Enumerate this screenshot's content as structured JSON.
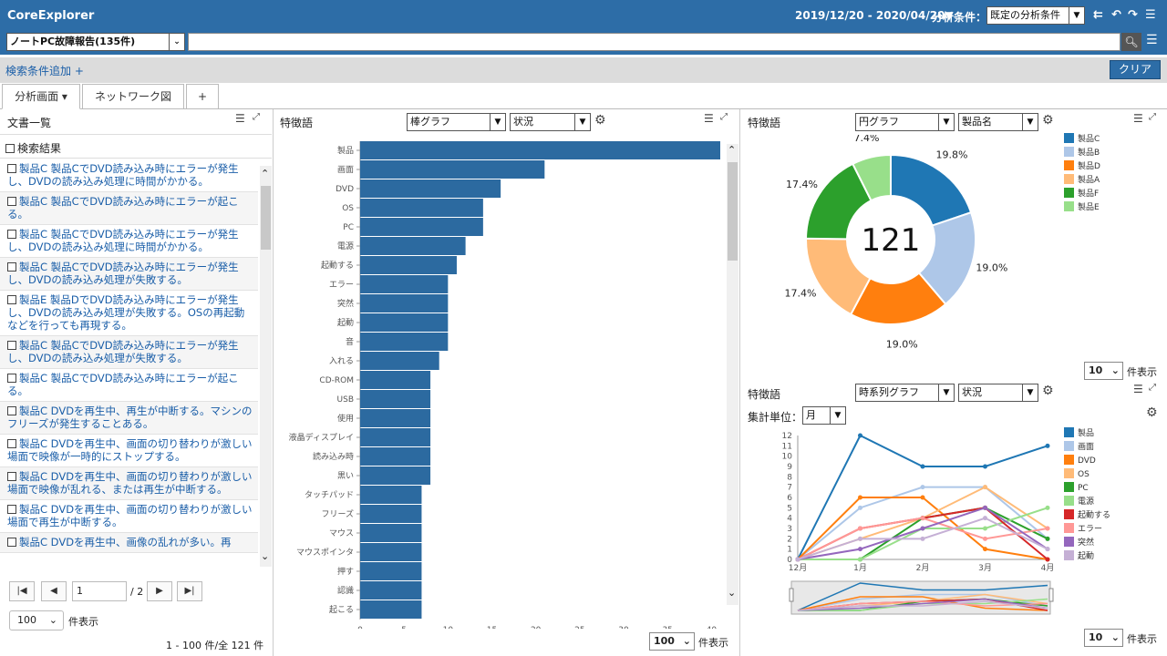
{
  "app": {
    "title": "CoreExplorer"
  },
  "header": {
    "date_range": "2019/12/20 - 2020/04/20▼",
    "condition_label": "分析条件：",
    "condition_value": "既定の分析条件",
    "icons": [
      "undo-all-icon",
      "undo-icon",
      "redo-icon",
      "menu-icon"
    ]
  },
  "search": {
    "dataset": "ノートPC故障報告(135件)",
    "query": ""
  },
  "filters": {
    "add_label": "検索条件追加 +",
    "clear_label": "クリア"
  },
  "tabs": [
    {
      "label": "分析画面 ▾"
    },
    {
      "label": "ネットワーク図"
    },
    {
      "label": "+"
    }
  ],
  "doc_panel": {
    "title": "文書一覧",
    "results_label": "検索結果",
    "docs": [
      "製品C 製品CでDVD読み込み時にエラーが発生し、DVDの読み込み処理に時間がかかる。",
      "製品C 製品CでDVD読み込み時にエラーが起こる。",
      "製品C 製品CでDVD読み込み時にエラーが発生し、DVDの読み込み処理に時間がかかる。",
      "製品C 製品CでDVD読み込み時にエラーが発生し、DVDの読み込み処理が失敗する。",
      "製品E 製品DでDVD読み込み時にエラーが発生し、DVDの読み込み処理が失敗する。OSの再起動などを行っても再現する。",
      "製品C 製品CでDVD読み込み時にエラーが発生し、DVDの読み込み処理が失敗する。",
      "製品C 製品CでDVD読み込み時にエラーが起こる。",
      "製品C DVDを再生中、再生が中断する。マシンのフリーズが発生することある。",
      "製品C DVDを再生中、画面の切り替わりが激しい場面で映像が一時的にストップする。",
      "製品C DVDを再生中、画面の切り替わりが激しい場面で映像が乱れる、または再生が中断する。",
      "製品C DVDを再生中、画面の切り替わりが激しい場面で再生が中断する。",
      "製品C DVDを再生中、画像の乱れが多い。再"
    ],
    "page": "1",
    "page_total": "/ 2",
    "per_page": "100",
    "per_page_label": "件表示",
    "range_label": "1 - 100 件/全 121 件"
  },
  "bar_panel": {
    "title": "特徴語",
    "chart_type": "棒グラフ",
    "field": "状況",
    "per_page": "100",
    "per_page_label": "件表示"
  },
  "pie_panel": {
    "title": "特徴語",
    "chart_type": "円グラフ",
    "field": "製品名",
    "center_value": "121",
    "per_page": "10",
    "per_page_label": "件表示"
  },
  "line_panel": {
    "title": "特徴語",
    "chart_type": "時系列グラフ",
    "field": "状況",
    "unit_label": "集計単位：",
    "unit_value": "月",
    "per_page": "10",
    "per_page_label": "件表示"
  },
  "chart_data": [
    {
      "type": "bar",
      "orientation": "horizontal",
      "categories": [
        "製品",
        "画面",
        "DVD",
        "OS",
        "PC",
        "電源",
        "起動する",
        "エラー",
        "突然",
        "起動",
        "音",
        "入れる",
        "CD-ROM",
        "USB",
        "使用",
        "液晶ディスプレイ",
        "読み込み時",
        "黒い",
        "タッチパッド",
        "フリーズ",
        "マウス",
        "マウスポインタ",
        "押す",
        "認識",
        "起こる"
      ],
      "values": [
        41,
        21,
        16,
        14,
        14,
        12,
        11,
        10,
        10,
        10,
        10,
        9,
        8,
        8,
        8,
        8,
        8,
        8,
        7,
        7,
        7,
        7,
        7,
        7,
        7
      ],
      "xlim": [
        0,
        41
      ],
      "xticks": [
        0,
        5,
        10,
        15,
        20,
        25,
        30,
        35,
        40
      ],
      "color": "#2c6aa0"
    },
    {
      "type": "pie",
      "style": "donut",
      "labels": [
        "製品C",
        "製品B",
        "製品D",
        "製品A",
        "製品F",
        "製品E"
      ],
      "values": [
        19.8,
        19.0,
        19.0,
        17.4,
        17.4,
        7.4
      ],
      "value_labels": [
        "19.8%",
        "19.0%",
        "19.0%",
        "17.4%",
        "17.4%",
        "7.4%"
      ],
      "colors": [
        "#1f77b4",
        "#aec7e8",
        "#ff7f0e",
        "#ffbb78",
        "#2ca02c",
        "#98df8a"
      ]
    },
    {
      "type": "line",
      "x": [
        "12月",
        "1月",
        "2月",
        "3月",
        "4月"
      ],
      "ylim": [
        0,
        12
      ],
      "yticks": [
        0,
        1,
        2,
        3,
        4,
        5,
        6,
        7,
        8,
        9,
        10,
        11,
        12
      ],
      "series": [
        {
          "name": "製品",
          "color": "#1f77b4",
          "values": [
            0,
            12,
            9,
            9,
            11
          ]
        },
        {
          "name": "画面",
          "color": "#aec7e8",
          "values": [
            0,
            5,
            7,
            7,
            2
          ]
        },
        {
          "name": "DVD",
          "color": "#ff7f0e",
          "values": [
            0,
            6,
            6,
            1,
            0
          ]
        },
        {
          "name": "OS",
          "color": "#ffbb78",
          "values": [
            0,
            2,
            4,
            7,
            3
          ]
        },
        {
          "name": "PC",
          "color": "#2ca02c",
          "values": [
            0,
            0,
            4,
            5,
            2
          ]
        },
        {
          "name": "電源",
          "color": "#98df8a",
          "values": [
            0,
            0,
            3,
            3,
            5
          ]
        },
        {
          "name": "起動する",
          "color": "#d62728",
          "values": [
            0,
            3,
            4,
            5,
            0
          ]
        },
        {
          "name": "エラー",
          "color": "#ff9896",
          "values": [
            0,
            3,
            4,
            2,
            3
          ]
        },
        {
          "name": "突然",
          "color": "#9467bd",
          "values": [
            0,
            1,
            3,
            5,
            1
          ]
        },
        {
          "name": "起動",
          "color": "#c5b0d5",
          "values": [
            0,
            2,
            2,
            4,
            1
          ]
        }
      ]
    }
  ]
}
